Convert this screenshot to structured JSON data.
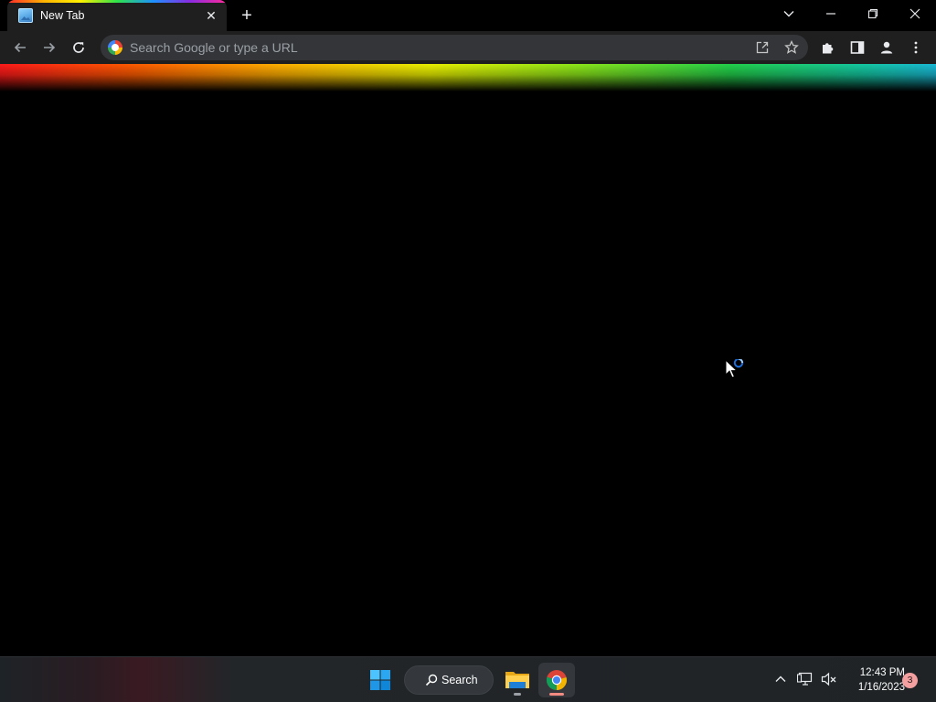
{
  "browser": {
    "tab": {
      "title": "New Tab",
      "close_glyph": "✕"
    },
    "new_tab_glyph": "+",
    "window_controls": {
      "tab_search": "⌄",
      "minimize": "—",
      "restore": "❐",
      "close": "✕"
    },
    "toolbar": {
      "back_glyph": "←",
      "forward_glyph": "→",
      "reload_glyph": "↻",
      "omnibox_placeholder": "Search Google or type a URL",
      "omnibox_value": "",
      "share_glyph": "⇪",
      "bookmark_glyph": "☆",
      "extensions_glyph": "✚",
      "side_panel_glyph": "◨",
      "profile_glyph": "●",
      "menu_glyph": "⋮"
    },
    "theme_colors": {
      "tab_bg": "#1f1f1f",
      "toolbar_bg": "#1f1f1f",
      "omnibox_bg": "#333538",
      "page_bg": "#000000"
    }
  },
  "taskbar": {
    "search_label": "Search",
    "pinned_apps": [
      "start-menu",
      "search",
      "file-explorer",
      "google-chrome"
    ],
    "tray": {
      "overflow_glyph": "^",
      "time": "12:43 PM",
      "date": "1/16/2023",
      "notification_count": "3"
    }
  }
}
